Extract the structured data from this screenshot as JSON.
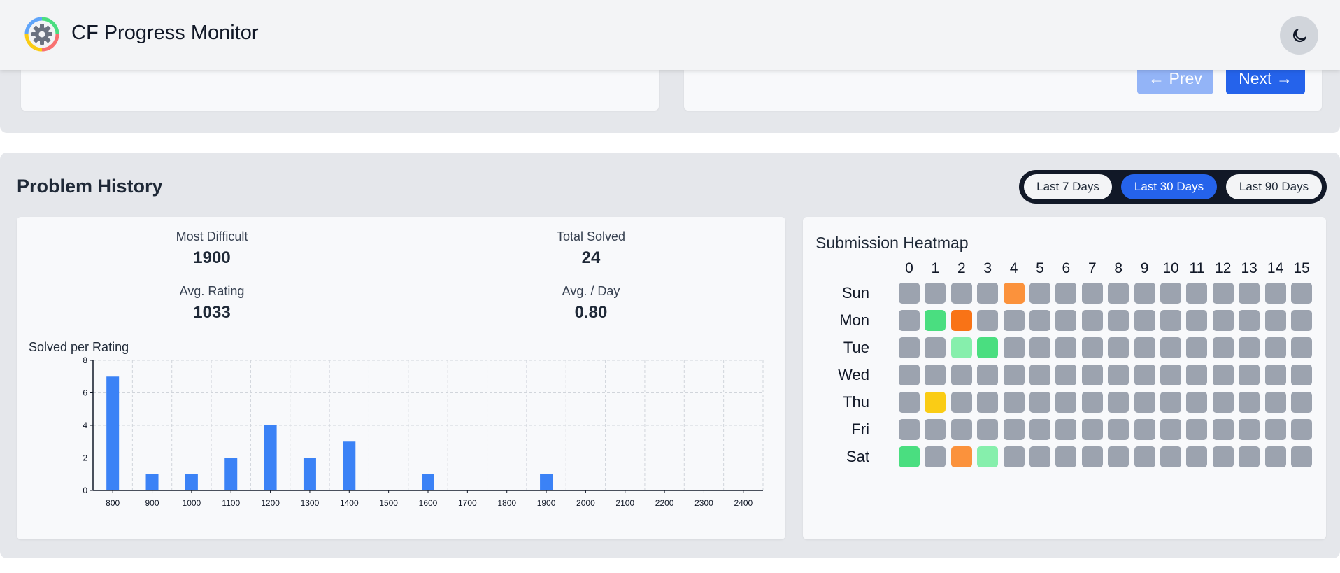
{
  "app": {
    "title": "CF Progress Monitor",
    "logo_icon": "gear-logo-icon",
    "theme_icon": "moon-icon"
  },
  "pagination": {
    "prev_label": "← Prev",
    "next_label": "Next →"
  },
  "history": {
    "title": "Problem History",
    "ranges": [
      {
        "label": "Last 7 Days",
        "active": false
      },
      {
        "label": "Last 30 Days",
        "active": true
      },
      {
        "label": "Last 90 Days",
        "active": false
      }
    ],
    "stats": {
      "most_difficult": {
        "label": "Most Difficult",
        "value": "1900"
      },
      "total_solved": {
        "label": "Total Solved",
        "value": "24"
      },
      "avg_rating": {
        "label": "Avg. Rating",
        "value": "1033"
      },
      "avg_per_day": {
        "label": "Avg. / Day",
        "value": "0.80"
      }
    },
    "chart_title": "Solved per Rating"
  },
  "chart_data": {
    "type": "bar",
    "title": "Solved per Rating",
    "categories": [
      "800",
      "900",
      "1000",
      "1100",
      "1200",
      "1300",
      "1400",
      "1500",
      "1600",
      "1700",
      "1800",
      "1900",
      "2000",
      "2100",
      "2200",
      "2300",
      "2400"
    ],
    "values": [
      7,
      1,
      1,
      2,
      4,
      2,
      3,
      0,
      1,
      0,
      0,
      1,
      0,
      0,
      0,
      0,
      0
    ],
    "yticks": [
      "0",
      "2",
      "4",
      "6",
      "8"
    ],
    "ylim": [
      0,
      8
    ],
    "grid": true,
    "bar_color": "#3b82f6"
  },
  "heatmap": {
    "title": "Submission Heatmap",
    "columns": [
      "0",
      "1",
      "2",
      "3",
      "4",
      "5",
      "6",
      "7",
      "8",
      "9",
      "10",
      "11",
      "12",
      "13",
      "14",
      "15"
    ],
    "rows": [
      "Sun",
      "Mon",
      "Tue",
      "Wed",
      "Thu",
      "Fri",
      "Sat"
    ],
    "palette": {
      "empty": "#9ca3af",
      "green": "#4ade80",
      "light-green": "#86efac",
      "orange": "#fb923c",
      "dark-orange": "#f97316",
      "yellow": "#facc15"
    },
    "colored_cells": [
      {
        "row": "Sun",
        "col": "4",
        "color": "orange"
      },
      {
        "row": "Mon",
        "col": "1",
        "color": "green"
      },
      {
        "row": "Mon",
        "col": "2",
        "color": "dark-orange"
      },
      {
        "row": "Tue",
        "col": "2",
        "color": "light-green"
      },
      {
        "row": "Tue",
        "col": "3",
        "color": "green"
      },
      {
        "row": "Thu",
        "col": "1",
        "color": "yellow"
      },
      {
        "row": "Sat",
        "col": "0",
        "color": "green"
      },
      {
        "row": "Sat",
        "col": "2",
        "color": "orange"
      },
      {
        "row": "Sat",
        "col": "3",
        "color": "light-green"
      }
    ]
  }
}
